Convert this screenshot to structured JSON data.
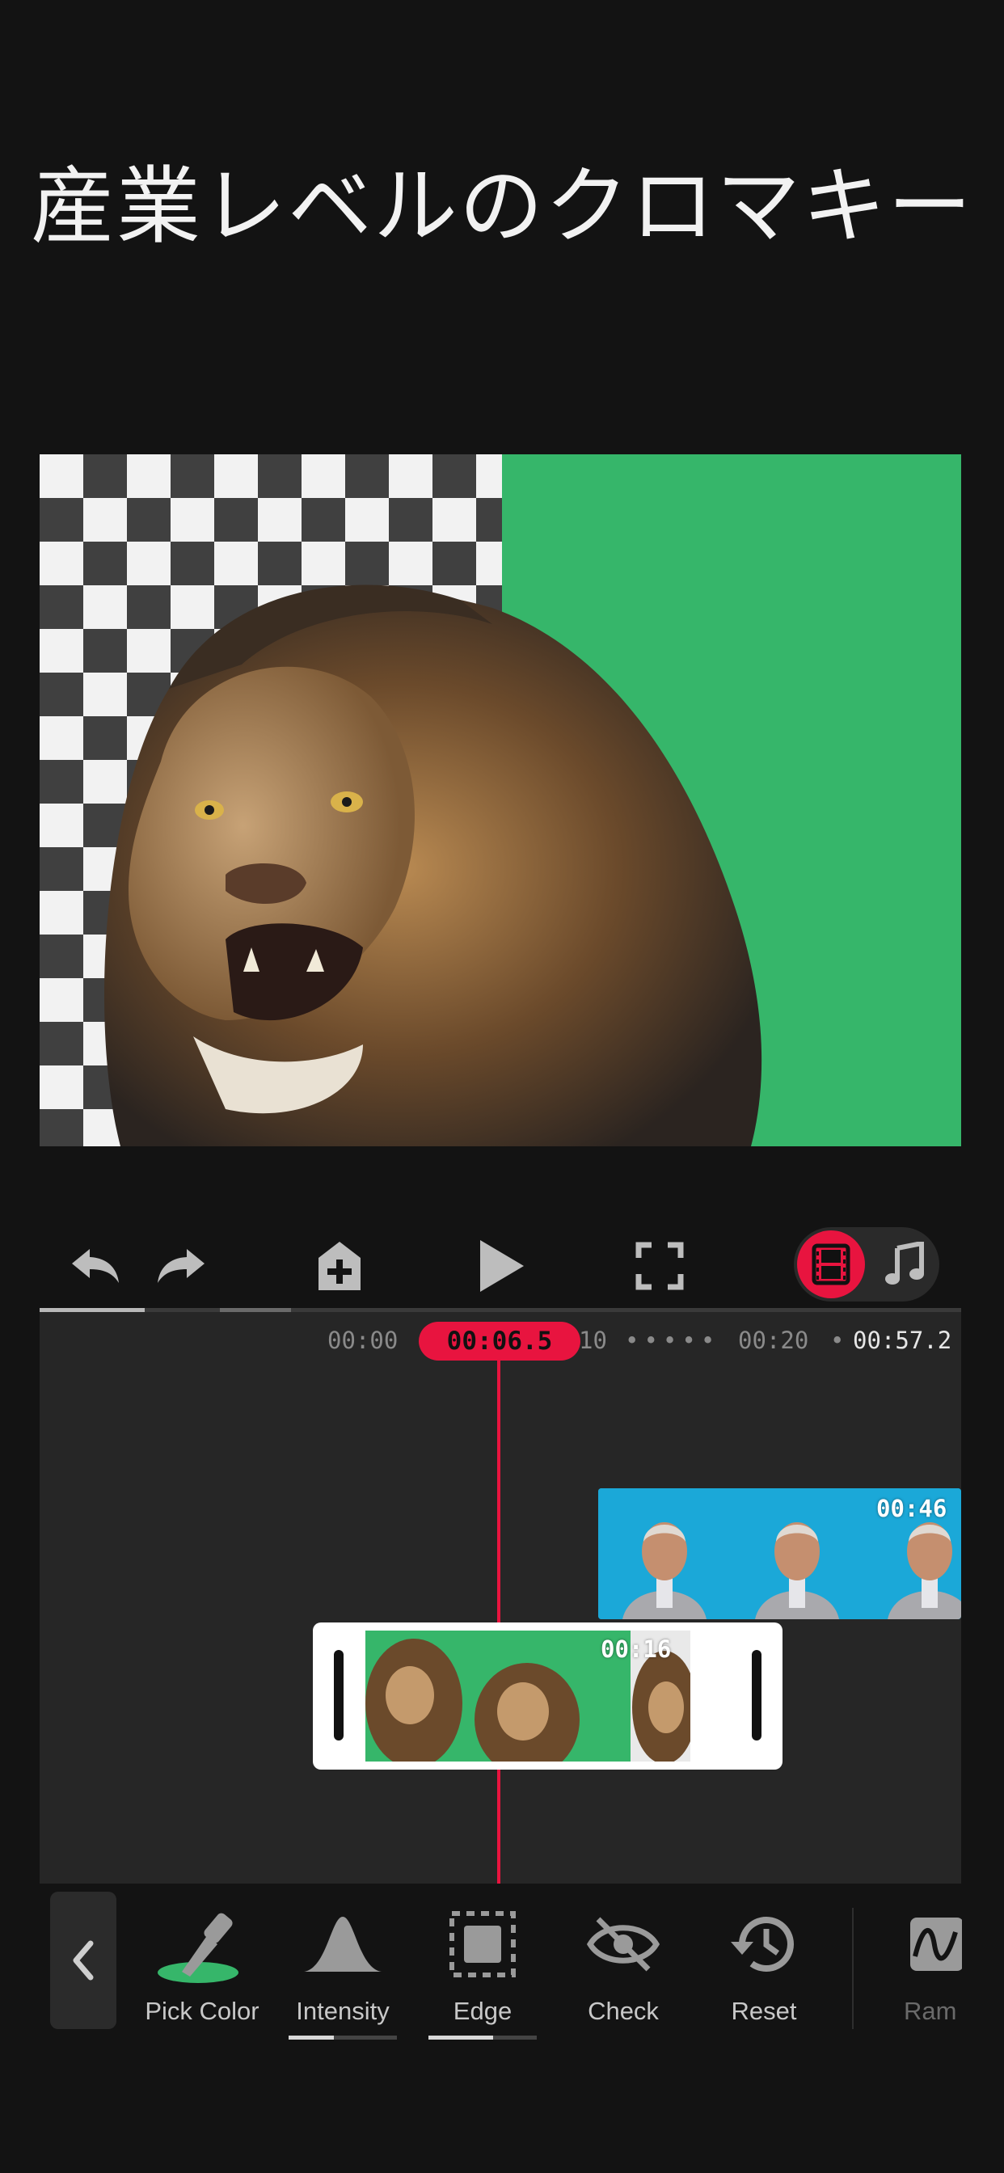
{
  "headline": "産業レベルのクロマキー",
  "toolbar": {
    "undo_icon": "undo-icon",
    "redo_icon": "redo-icon",
    "add_icon": "add-layer-icon",
    "play_icon": "play-icon",
    "fullscreen_icon": "fullscreen-icon",
    "video_mode_icon": "film-icon",
    "audio_mode_icon": "music-note-icon",
    "accent_color": "#e8143f"
  },
  "timeline": {
    "ruler": {
      "t0": "00:00",
      "t10": "10",
      "t20": "00:20",
      "total": "00:57.2"
    },
    "playhead_time": "00:06.5",
    "clips": [
      {
        "name": "presenter-clip",
        "duration": "00:46"
      },
      {
        "name": "lion-clip",
        "duration": "00:16"
      }
    ]
  },
  "tools": {
    "items": [
      {
        "label": "Pick Color",
        "icon": "eyedropper-icon"
      },
      {
        "label": "Intensity",
        "icon": "intensity-curve-icon"
      },
      {
        "label": "Edge",
        "icon": "edge-select-icon"
      },
      {
        "label": "Check",
        "icon": "eye-off-icon"
      },
      {
        "label": "Reset",
        "icon": "history-reset-icon"
      },
      {
        "label": "Ram",
        "icon": "ramp-wave-icon"
      }
    ],
    "back_icon": "chevron-left-icon",
    "pick_color_swatch": "#36b66a"
  }
}
